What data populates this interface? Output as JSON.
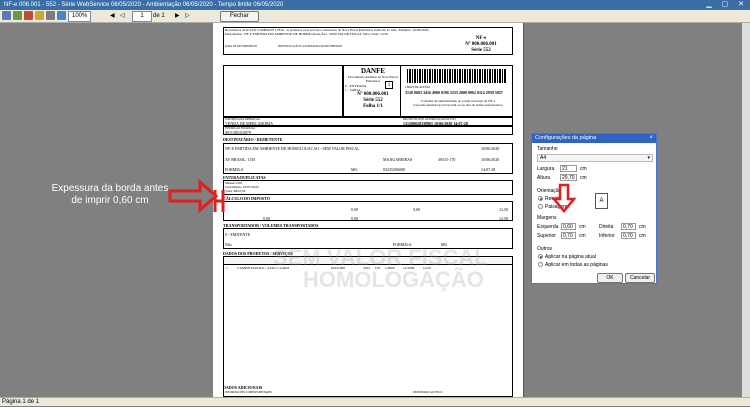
{
  "window": {
    "title": "NF-e 006.001 - 552 - Série WebService 06/05/2020 - Ambientação 06/05/2020 - Tempo limite 06/05/2020",
    "controls": "▁ ▢ ✕"
  },
  "toolbar": {
    "zoom": "100%",
    "page": "1",
    "page_of": "de 1",
    "close_label": "Fechar"
  },
  "status": {
    "text": "Página 1 de 1"
  },
  "danfe": {
    "receipt_text": "Recebemos de ILLYO COMPANY LTDA. os produtos e/ou serviços constantes da Nota Fiscal Eletrônica indicada ao lado. Emissão: 10/06/2020 - Dest./Reme.: NF-E EMITIDA EM AMBIENTE DE HOMOLOGAÇÃO - SEM VALOR FISCAL  Valor Total: 12,50",
    "receipt_date_label": "DATA DE RECEBIMENTO",
    "receipt_sign_label": "IDENTIFICAÇÃO E ASSINATURA DO RECEBEDOR",
    "stub_nfe": "NF-e",
    "stub_number": "Nº 000.006.001",
    "stub_serie": "Série 552",
    "title": "DANFE",
    "subtitle": "Documento Auxiliar da Nota Fiscal Eletrônica",
    "entrada": "0 - ENTRADA",
    "saida": "1 - SAÍDA",
    "tipo": "1",
    "number": "Nº 000.006.001",
    "serie": "Série 552",
    "folha": "Folha 1/1",
    "chave_label": "CHAVE DE ACESSO",
    "chave": "3120 0683 3416 4900 0186 5555 2000 0062 0114 2939 5827",
    "consulta": "Consulta de autenticidade no portal nacional da NF-e www.nfe.fazenda.gov.br/portal ou no site da Sefaz Autorizadora",
    "natureza_label": "NATUREZA DA OPERAÇÃO",
    "natureza": "VENDA DE MERCADORIA",
    "protocolo_label": "PROTOCOLO DE AUTORIZAÇÃO DE USO",
    "protocolo": "131200020338965 10/06/2020 14:07:28",
    "ie_label": "INSCRIÇÃO ESTADUAL",
    "ie": "0011385310079",
    "dest_header": "DESTINATÁRIO / REMETENTE",
    "dest_name": "NF-E EMITIDA EM AMBIENTE DE HOMOLOGACAO - SEM VALOR FISCAL",
    "dest_date": "10/06/2020",
    "dest_address": "AV BRASIL, 1150",
    "dest_bairro": "MANGABEIRAS",
    "dest_cep": "30315-170",
    "dest_saida": "10/06/2020",
    "dest_city": "FORMIGA",
    "dest_uf": "MG",
    "dest_fone": "03235206008",
    "dest_hora": "14:07:28",
    "fatura_header": "FATURA/DUPLICATAS",
    "fatura_num_label": "Número",
    "fatura_num": "001",
    "fatura_venc_label": "Vencimento",
    "fatura_venc": "10/07/2020",
    "fatura_valor_label": "Valor",
    "fatura_valor": "R$12,50",
    "imposto_header": "CÁLCULO DO IMPOSTO",
    "v_zero": "0,00",
    "v_total": "12,50",
    "transp_header": "TRANSPORTADOR / VOLUMES TRANSPORTADOS",
    "frete": "0 - EMITENTE",
    "transp_city": "FORMIGA",
    "transp_uf": "MG",
    "transp_especie": "Não",
    "produtos_header": "DADOS DOS PRODUTOS / SERVIÇOS",
    "item_code": "1",
    "item_desc": "CAMISETA POLO - AZUL CLARO",
    "item_ncm": "61051000",
    "item_cfop": "5102",
    "item_un": "UN",
    "item_qtd": "1,0000",
    "item_vunit": "12,5000",
    "item_vtotal": "12,50",
    "adicionais_header": "DADOS ADICIONAIS",
    "adicionais_label": "INFORMAÇÕES COMPLEMENTARES",
    "reservado_label": "RESERVADO AO FISCO",
    "watermark1": "SEM VALOR FISCAL",
    "watermark2": "HOMOLOGAÇÃO"
  },
  "annotation": {
    "line1": "Expessura da borda antes",
    "line2": "de imprir 0,60 cm"
  },
  "dialog": {
    "title": "Configurações da página",
    "close": "×",
    "tamanho_label": "Tamanho",
    "tamanho_value": "A4",
    "largura_label": "Largura",
    "largura_value": "21",
    "altura_label": "Altura",
    "altura_value": "29,70",
    "unit": "cm",
    "orientacao_label": "Orientação",
    "retrato_label": "Retrato",
    "paisagem_label": "Paisagem",
    "margens_label": "Margens",
    "esquerda_label": "Esquerda",
    "esquerda_value": "0,60",
    "direita_label": "Direita",
    "direita_value": "0,70",
    "superior_label": "Superior",
    "superior_value": "0,70",
    "inferior_label": "Inferior",
    "inferior_value": "0,70",
    "outros_label": "Outros",
    "aplicar_atual": "Aplicar na página atual",
    "aplicar_todas": "Aplicar em todas as páginas",
    "ok_label": "OK",
    "cancel_label": "Cancelar",
    "preview_letter": "A"
  },
  "colors": {
    "arrow": "#e21e1e",
    "title_bar": "#2f64c4",
    "page_bg": "#808080"
  }
}
